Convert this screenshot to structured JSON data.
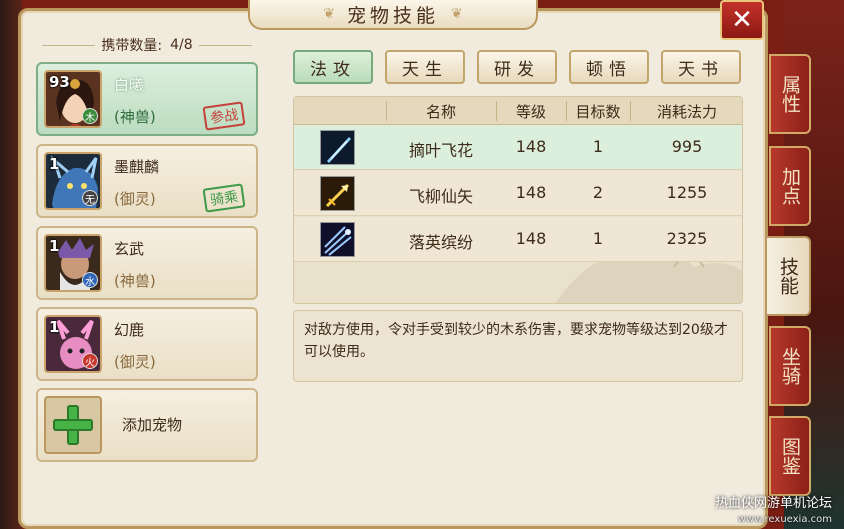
{
  "window": {
    "title": "宠物技能"
  },
  "carry": {
    "label": "携带数量:",
    "value": "4/8"
  },
  "pets": [
    {
      "level": "93",
      "element": "木",
      "name": "白曦",
      "type": "(神兽)",
      "status": "参战",
      "active": true
    },
    {
      "level": "1",
      "element": "无",
      "name": "墨麒麟",
      "type": "(御灵)",
      "status": "骑乘",
      "active": false
    },
    {
      "level": "1",
      "element": "水",
      "name": "玄武",
      "type": "(神兽)",
      "status": "",
      "active": false
    },
    {
      "level": "1",
      "element": "火",
      "name": "幻鹿",
      "type": "(御灵)",
      "status": "",
      "active": false
    }
  ],
  "add_pet": {
    "label": "添加宠物"
  },
  "tabs": [
    "法攻",
    "天生",
    "研发",
    "顿悟",
    "天书"
  ],
  "active_tab": "法攻",
  "skill_table": {
    "columns": [
      "名称",
      "等级",
      "目标数",
      "消耗法力"
    ],
    "rows": [
      {
        "icon": "blue-leaf-blade-icon",
        "name": "摘叶飞花",
        "level": "148",
        "targets": "1",
        "mana": "995"
      },
      {
        "icon": "golden-arrow-icon",
        "name": "飞柳仙矢",
        "level": "148",
        "targets": "2",
        "mana": "1255"
      },
      {
        "icon": "blue-trident-icon",
        "name": "落英缤纷",
        "level": "148",
        "targets": "1",
        "mana": "2325"
      }
    ]
  },
  "description": "对敌方使用，令对手受到较少的木系伤害，要求宠物等级达到20级才可以使用。",
  "side_tabs": [
    {
      "label": "属性",
      "active": false
    },
    {
      "label": "加点",
      "active": false
    },
    {
      "label": "技能",
      "active": true
    },
    {
      "label": "坐骑",
      "active": false
    },
    {
      "label": "图鉴",
      "active": false
    }
  ],
  "watermark": {
    "text": "热血侠网游单机论坛",
    "url": "www.rexuexia.com"
  },
  "colors": {
    "active_green": "#b9dcbc",
    "frame_gold": "#b9975d",
    "stamp_red": "#c4423a",
    "stamp_green": "#3f9a4a"
  }
}
